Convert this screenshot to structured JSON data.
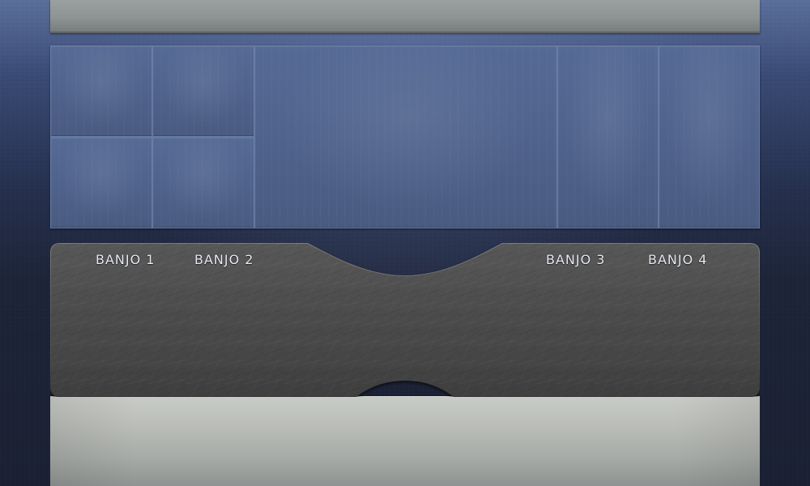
{
  "tabs": [
    {
      "label": "BANJO 1"
    },
    {
      "label": "BANJO 2"
    },
    {
      "label": "BANJO 3"
    },
    {
      "label": "BANJO 4"
    }
  ],
  "theme": {
    "background_top": "#5b6f9c",
    "background_bottom": "#1b2133",
    "grid_cell": "#4f628b",
    "control_panel": "#4a4a4a",
    "top_bar": "#8e9393",
    "bottom_panel": "#b9bcb7"
  }
}
